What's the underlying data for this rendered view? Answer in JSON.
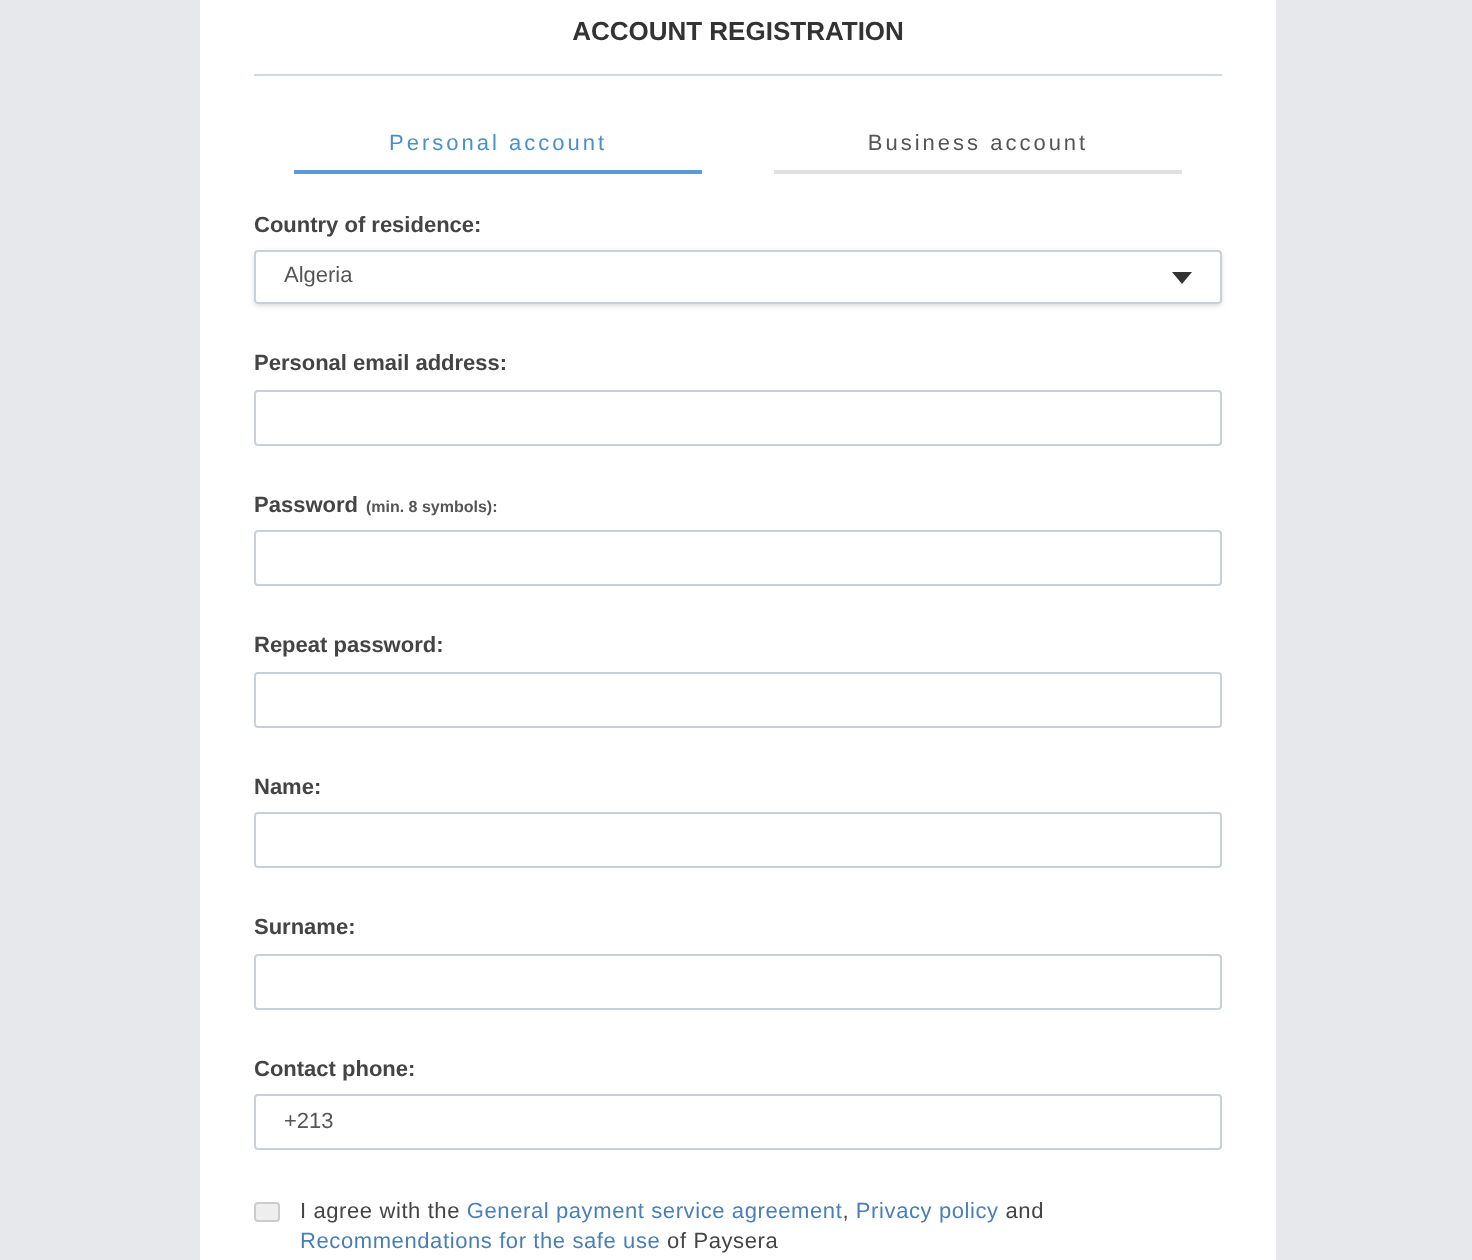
{
  "title": "ACCOUNT REGISTRATION",
  "tabs": [
    {
      "label": "Personal account",
      "selected": true
    },
    {
      "label": "Business account",
      "selected": false
    }
  ],
  "fields": [
    {
      "kind": "select",
      "label": "Country of residence:",
      "value": "Algeria"
    },
    {
      "kind": "input",
      "label": "Personal email address:"
    },
    {
      "kind": "input",
      "label": "Password",
      "hint": "(min. 8 symbols):"
    },
    {
      "kind": "input",
      "label": "Repeat password:"
    },
    {
      "kind": "input",
      "label": "Name:"
    },
    {
      "kind": "input",
      "label": "Surname:"
    },
    {
      "kind": "input",
      "label": "Contact phone:",
      "value": "+213"
    }
  ],
  "agreement": {
    "checked": false,
    "parts": [
      {
        "kind": "text",
        "text": "I agree with the "
      },
      {
        "kind": "link",
        "text": "General payment service agreement"
      },
      {
        "kind": "text",
        "text": ", "
      },
      {
        "kind": "link",
        "text": "Privacy policy"
      },
      {
        "kind": "text",
        "text": " and "
      },
      {
        "kind": "link",
        "text": "Recommendations for the safe use"
      },
      {
        "kind": "text",
        "text": " of Paysera"
      }
    ]
  }
}
